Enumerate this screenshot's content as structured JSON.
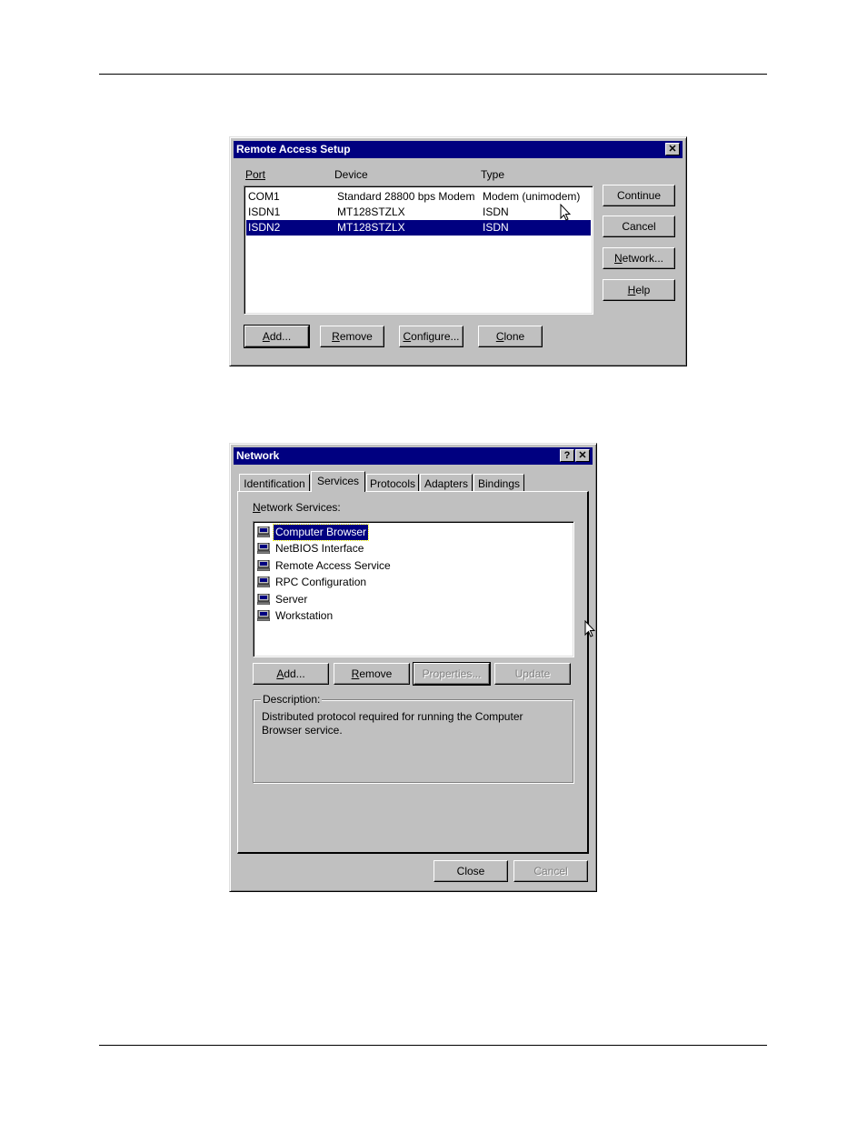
{
  "remote_access": {
    "title": "Remote Access Setup",
    "close_glyph": "✕",
    "columns": {
      "port": "Port",
      "device": "Device",
      "type": "Type"
    },
    "rows": [
      {
        "port": "COM1",
        "device": "Standard 28800 bps Modem",
        "type": "Modem (unimodem)"
      },
      {
        "port": "ISDN1",
        "device": "MT128STZLX",
        "type": "ISDN"
      },
      {
        "port": "ISDN2",
        "device": "MT128STZLX",
        "type": "ISDN"
      }
    ],
    "selected_row": "ISDN2",
    "buttons": {
      "continue": "Continue",
      "cancel": "Cancel",
      "network": "Network...",
      "help": "Help",
      "add": "Add...",
      "remove": "Remove",
      "configure": "Configure...",
      "clone": "Clone"
    }
  },
  "network": {
    "title": "Network",
    "help_glyph": "?",
    "close_glyph": "✕",
    "tabs": [
      "Identification",
      "Services",
      "Protocols",
      "Adapters",
      "Bindings"
    ],
    "active_tab": "Services",
    "services_label": "Network Services:",
    "services": [
      "Computer Browser",
      "NetBIOS Interface",
      "Remote Access Service",
      "RPC Configuration",
      "Server",
      "Workstation"
    ],
    "selected_service": "Computer Browser",
    "buttons": {
      "add": "Add...",
      "remove": "Remove",
      "properties": "Properties...",
      "update": "Update",
      "close": "Close",
      "cancel": "Cancel"
    },
    "description_label": "Description:",
    "description_text": "Distributed protocol required for running the Computer Browser service."
  },
  "colors": {
    "titlebar": "#000080",
    "face": "#c0c0c0",
    "selection": "#000080"
  },
  "icons": [
    "close-icon",
    "help-icon",
    "computer-service-icon",
    "mouse-cursor-icon"
  ]
}
